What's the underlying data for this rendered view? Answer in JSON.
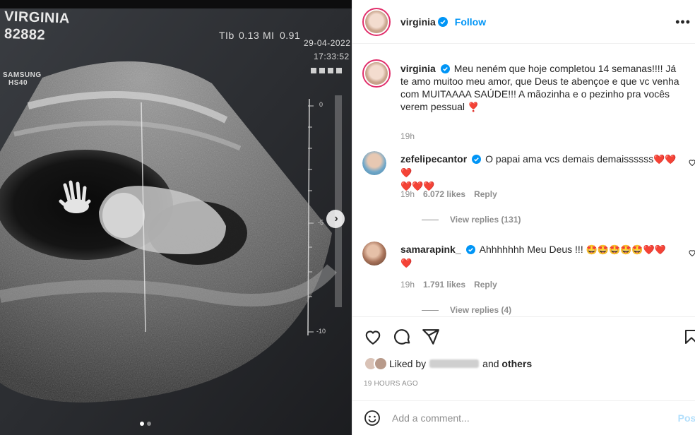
{
  "media": {
    "patient_name": "VIRGINIA",
    "patient_id": "82882",
    "device_brand": "SAMSUNG",
    "device_model": "HS40",
    "tib_label": "TIb",
    "tib_value": "0.13",
    "mi_label": "MI",
    "mi_value": "0.91",
    "date": "29-04-2022",
    "time": "17:33:52",
    "scale_labels": [
      "0",
      "-5",
      "-10"
    ],
    "next_icon": "chevron-right-icon",
    "carousel_index": 1,
    "carousel_total": 2
  },
  "header": {
    "username": "virginia",
    "follow_label": "Follow",
    "more_icon": "more-horizontal-icon"
  },
  "caption": {
    "username": "virginia",
    "text": "Meu neném que hoje completou 14 semanas!!!! Já te amo muitoo meu amor, que Deus te abençoe e que vc venha com MUITAAAA SAÚDE!!! A mãozinha e o pezinho pra vocês verem pessual",
    "emoji": "❣️",
    "time": "19h"
  },
  "comments": [
    {
      "username": "zefelipecantor",
      "text": "O papai ama vcs demais demaissssss",
      "emoji_line1": "❤️❤️❤️",
      "emoji_line2": "❤️❤️❤️",
      "time": "19h",
      "likes": "6.072 likes",
      "reply_label": "Reply",
      "view_replies": "View replies (131)"
    },
    {
      "username": "samarapink_",
      "text": "Ahhhhhhh Meu Deus !!!",
      "emoji_line1": "🤩🤩🤩🤩🤩❤️❤️",
      "emoji_line2": "❤️",
      "time": "19h",
      "likes": "1.791 likes",
      "reply_label": "Reply",
      "view_replies": "View replies (4)"
    }
  ],
  "likes": {
    "prefix": "Liked by",
    "suffix": "and",
    "others": "others"
  },
  "time_ago": "19 HOURS AGO",
  "add_comment": {
    "placeholder": "Add a comment...",
    "post_label": "Post"
  },
  "colors": {
    "accent": "#0095f6",
    "like_red": "#ed1f2d",
    "text": "#262626",
    "muted": "#8e8e8e"
  }
}
